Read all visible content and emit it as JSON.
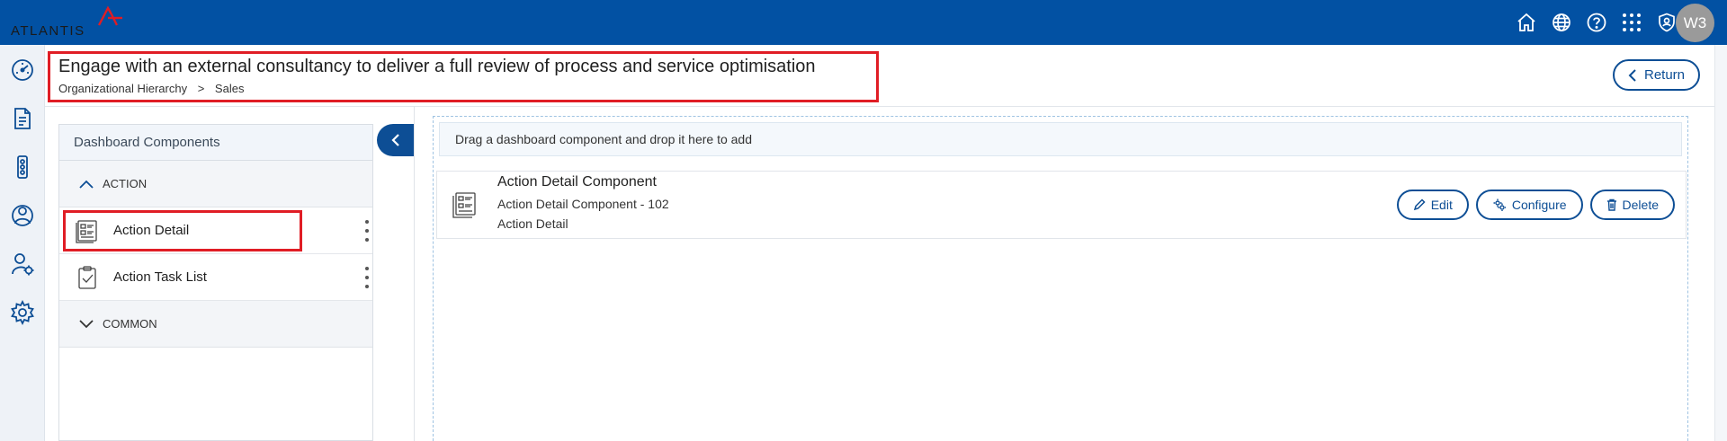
{
  "app": {
    "logo_text": "ATLANTIS",
    "avatar_initials": "W3",
    "icons": [
      "home-icon",
      "globe-icon",
      "help-icon",
      "apps-grid-icon",
      "shield-user-icon"
    ],
    "colors": {
      "primary": "#0251a3",
      "accent_dark": "#0d4e95",
      "highlight": "#e01d25"
    }
  },
  "sidebar": {
    "items": [
      {
        "icon": "dashboard-gauge-icon"
      },
      {
        "icon": "document-icon"
      },
      {
        "icon": "traffic-light-icon"
      },
      {
        "icon": "network-person-icon"
      },
      {
        "icon": "user-settings-icon"
      },
      {
        "icon": "settings-gear-icon"
      }
    ]
  },
  "header": {
    "title": "Engage with an external consultancy to deliver a full review of process and service optimisation",
    "breadcrumb": [
      "Organizational Hierarchy",
      ">",
      "Sales"
    ],
    "return_label": "Return"
  },
  "components_panel": {
    "title": "Dashboard Components",
    "groups": [
      {
        "label": "ACTION",
        "expanded": true,
        "items": [
          {
            "label": "Action Detail",
            "icon": "action-detail-icon"
          },
          {
            "label": "Action Task List",
            "icon": "clipboard-check-icon"
          }
        ]
      },
      {
        "label": "COMMON",
        "expanded": false,
        "items": []
      }
    ]
  },
  "dropzone": {
    "hint": "Drag a dashboard component and drop it here to add",
    "components": [
      {
        "title": "Action Detail Component",
        "subtitle": "Action Detail Component - 102",
        "type": "Action Detail",
        "buttons": {
          "edit": "Edit",
          "configure": "Configure",
          "delete": "Delete"
        }
      }
    ]
  }
}
